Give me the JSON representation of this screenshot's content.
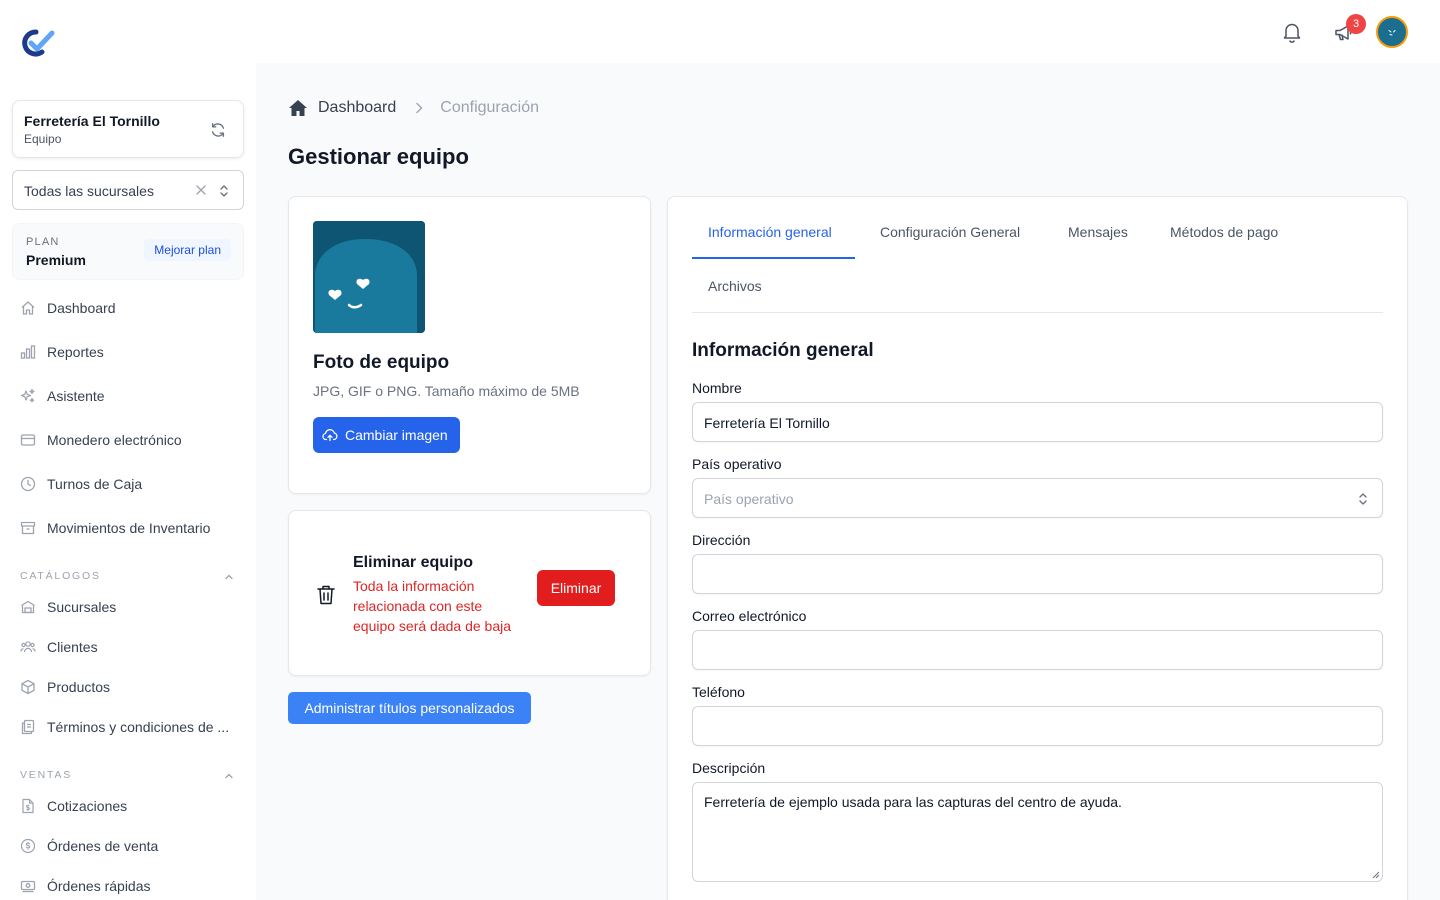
{
  "sidebar": {
    "team_name": "Ferretería El Tornillo",
    "team_role": "Equipo",
    "branch_select_value": "Todas las sucursales",
    "plan_label": "PLAN",
    "plan_value": "Premium",
    "upgrade_label": "Mejorar plan",
    "items": [
      {
        "label": "Dashboard",
        "icon": "home-icon"
      },
      {
        "label": "Reportes",
        "icon": "bar-chart-icon"
      },
      {
        "label": "Asistente",
        "icon": "sparkles-icon"
      },
      {
        "label": "Monedero electrónico",
        "icon": "wallet-icon"
      },
      {
        "label": "Turnos de Caja",
        "icon": "clock-icon"
      },
      {
        "label": "Movimientos de Inventario",
        "icon": "archive-box-icon"
      }
    ],
    "catalogs_title": "CATÁLOGOS",
    "catalogs": [
      {
        "label": "Sucursales",
        "icon": "building-icon"
      },
      {
        "label": "Clientes",
        "icon": "users-icon"
      },
      {
        "label": "Productos",
        "icon": "cube-icon"
      },
      {
        "label": "Términos y condiciones de ...",
        "icon": "documents-icon"
      }
    ],
    "sales_title": "VENTAS",
    "sales": [
      {
        "label": "Cotizaciones",
        "icon": "document-dollar-icon"
      },
      {
        "label": "Órdenes de venta",
        "icon": "currency-circle-icon"
      },
      {
        "label": "Órdenes rápidas",
        "icon": "banknotes-icon"
      }
    ]
  },
  "topbar": {
    "notification_count": "3"
  },
  "breadcrumb": {
    "home": "Dashboard",
    "current": "Configuración"
  },
  "page_title": "Gestionar equipo",
  "photo_card": {
    "title": "Foto de equipo",
    "help": "JPG, GIF o PNG. Tamaño máximo de 5MB",
    "button": "Cambiar imagen"
  },
  "delete_card": {
    "title": "Eliminar equipo",
    "warning": "Toda la información relacionada con este equipo será dada de baja",
    "button": "Eliminar"
  },
  "custom_titles_button": "Administrar títulos personalizados",
  "tabs": [
    "Información general",
    "Configuración General",
    "Mensajes",
    "Métodos de pago",
    "Archivos"
  ],
  "active_tab": "Información general",
  "form": {
    "section_title": "Información general",
    "name_label": "Nombre",
    "name_value": "Ferretería El Tornillo",
    "country_label": "País operativo",
    "country_placeholder": "País operativo",
    "address_label": "Dirección",
    "address_value": "",
    "email_label": "Correo electrónico",
    "email_value": "",
    "phone_label": "Teléfono",
    "phone_value": "",
    "description_label": "Descripción",
    "description_value": "Ferretería de ejemplo usada para las capturas del centro de ayuda."
  },
  "colors": {
    "primary": "#2563eb",
    "danger": "#e11d1d",
    "secondary_button": "#3b82f6",
    "badge": "#ef4444"
  }
}
